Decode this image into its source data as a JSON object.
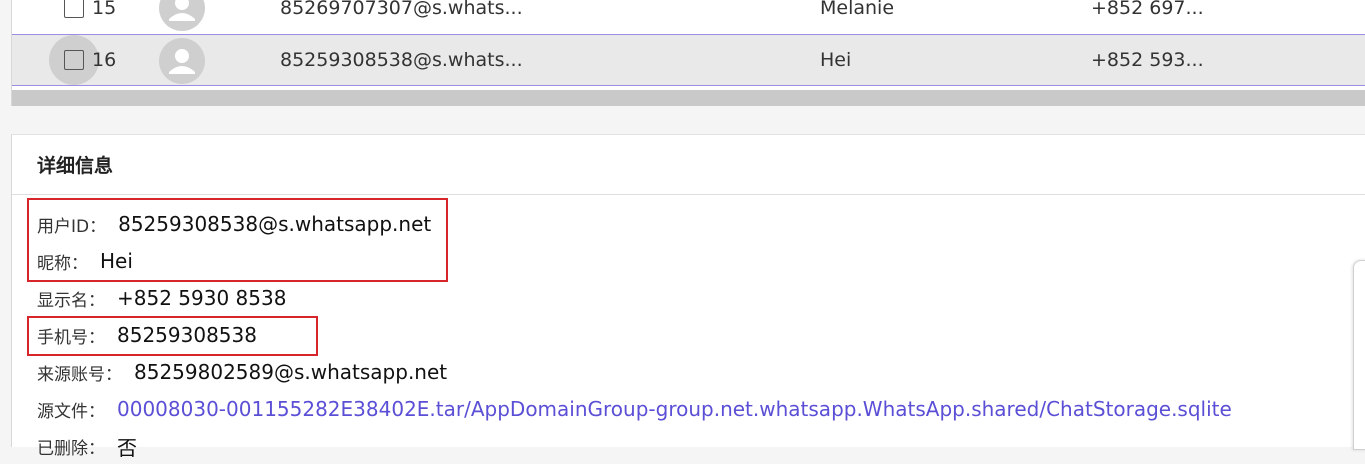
{
  "table": {
    "rows": [
      {
        "index": "15",
        "user_id": "85269707307@s.whats...",
        "nickname": "Melanie",
        "phone": "+852 697..."
      },
      {
        "index": "16",
        "user_id": "85259308538@s.whats...",
        "nickname": "Hei",
        "phone": "+852 593..."
      }
    ]
  },
  "detail": {
    "title": "详细信息",
    "fields": {
      "user_id": {
        "label": "用户ID：",
        "value": "85259308538@s.whatsapp.net"
      },
      "nickname": {
        "label": "昵称：",
        "value": "Hei"
      },
      "display_name": {
        "label": "显示名：",
        "value": "+852 5930 8538"
      },
      "phone": {
        "label": "手机号：",
        "value": "85259308538"
      },
      "source_account": {
        "label": "来源账号：",
        "value": "85259802589@s.whatsapp.net"
      },
      "source_file": {
        "label": "源文件：",
        "value": "00008030-001155282E38402E.tar/AppDomainGroup-group.net.whatsapp.WhatsApp.shared/ChatStorage.sqlite"
      },
      "deleted": {
        "label": "已删除：",
        "value": "否"
      }
    }
  },
  "colors": {
    "link": "#5b4fd6",
    "highlight_border": "#d6262b",
    "selected_row_border": "#9a8fe0"
  },
  "icons": {
    "checkbox": "checkbox-icon",
    "avatar": "person-placeholder-icon"
  }
}
